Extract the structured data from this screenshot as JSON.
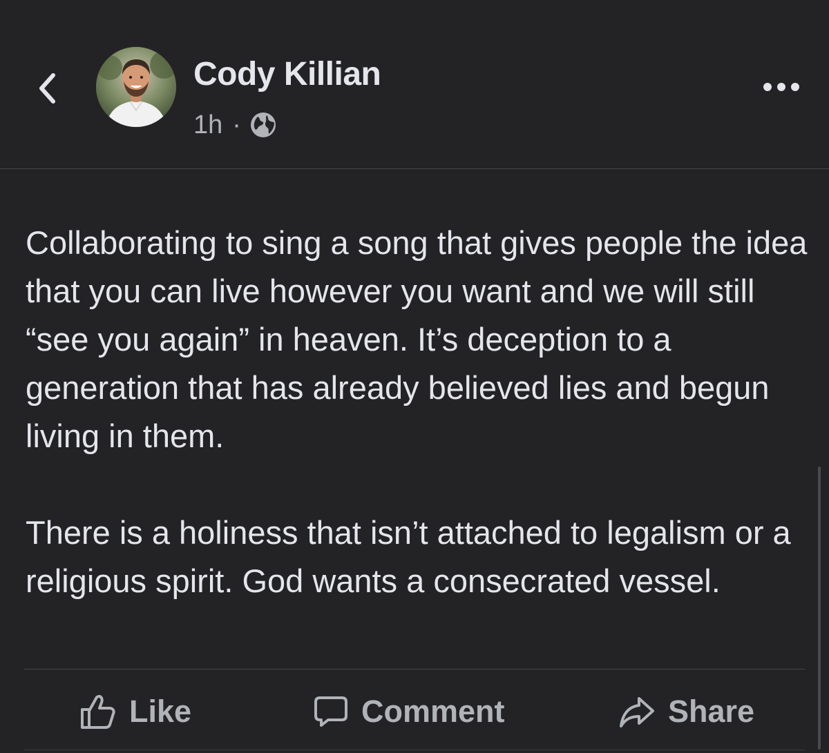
{
  "post": {
    "author": "Cody Killian",
    "time": "1h",
    "separator": "·",
    "privacy_icon": "globe-icon",
    "paragraphs": [
      "Collaborating to sing a song that gives people the idea that you can live however you want and we will still “see you again” in heaven. It’s deception to a generation that has already believed lies and begun living in them.",
      "There is a holiness that isn’t attached to legalism or a religious spirit. God wants a consecrated vessel."
    ]
  },
  "nav": {
    "back_icon": "chevron-left-icon",
    "more_icon": "more-horizontal-icon"
  },
  "actions": {
    "like_label": "Like",
    "comment_label": "Comment",
    "share_label": "Share"
  },
  "colors": {
    "background": "#232325",
    "text_primary": "#e4e6eb",
    "text_secondary": "#b0b3b8",
    "divider": "#47484b"
  }
}
